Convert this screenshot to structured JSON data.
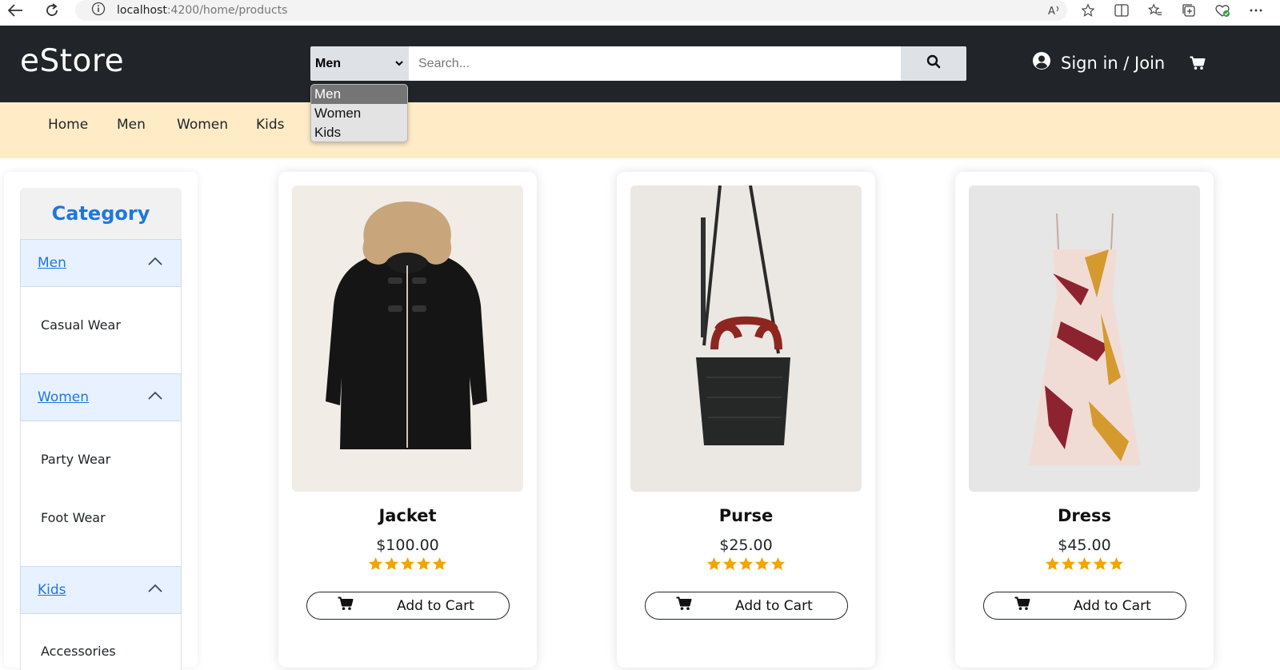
{
  "browser": {
    "url_host": "localhost",
    "url_path": ":4200/home/products"
  },
  "header": {
    "brand": "eStore",
    "category_selected": "Men",
    "search_placeholder": "Search...",
    "signin_label": "Sign in / Join"
  },
  "dropdown": {
    "options": [
      "Men",
      "Women",
      "Kids"
    ],
    "selected": "Men"
  },
  "nav": {
    "items": [
      "Home",
      "Men",
      "Women",
      "Kids"
    ]
  },
  "sidebar": {
    "title": "Category",
    "sections": [
      {
        "label": "Men",
        "items": [
          "Casual Wear"
        ]
      },
      {
        "label": "Women",
        "items": [
          "Party Wear",
          "Foot Wear"
        ]
      },
      {
        "label": "Kids",
        "items": [
          "Accessories"
        ]
      }
    ]
  },
  "products": [
    {
      "name": "Jacket",
      "price": "$100.00",
      "rating": 5,
      "button": "Add to Cart"
    },
    {
      "name": "Purse",
      "price": "$25.00",
      "rating": 5,
      "button": "Add to Cart"
    },
    {
      "name": "Dress",
      "price": "$45.00",
      "rating": 5,
      "button": "Add to Cart"
    }
  ],
  "icons": {
    "back": "back-arrow-icon",
    "refresh": "refresh-icon",
    "info": "info-icon",
    "search": "search-icon",
    "user": "user-circle-icon",
    "cart": "cart-icon",
    "chevron": "chevron-up-icon",
    "star": "star-icon"
  },
  "colors": {
    "header_bg": "#212529",
    "nav_bg": "#ffecc7",
    "accent_blue": "#1e78dc",
    "star": "#f5a300",
    "accordion_bg": "#e7f1ff"
  }
}
